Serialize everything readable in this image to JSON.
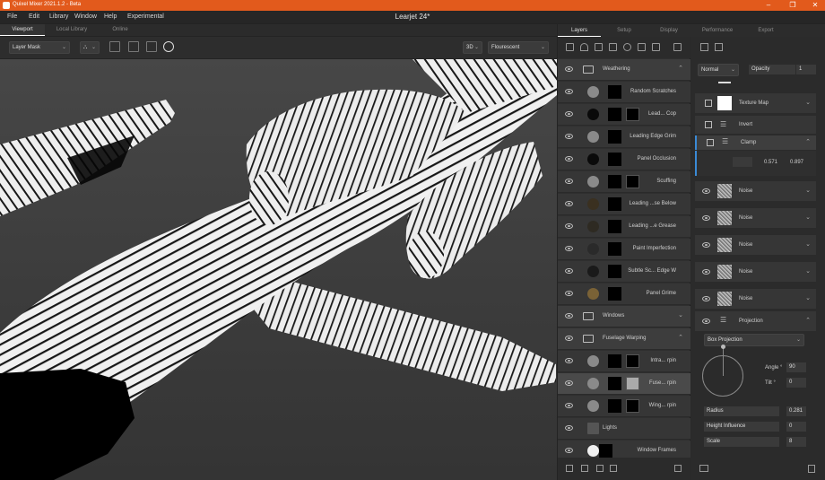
{
  "app": {
    "title": "Quixel Mixer 2021.1.2 - Beta",
    "document": "Learjet 24*"
  },
  "window_controls": {
    "minimize": "–",
    "maximize": "❐",
    "close": "✕"
  },
  "menu": [
    "File",
    "Edit",
    "Library",
    "Window",
    "Help",
    "Experimental"
  ],
  "left_tabs": [
    "Viewport",
    "Local Library",
    "Online"
  ],
  "viewport_toolbar": {
    "mask_dropdown": "Layer Mask",
    "view_mode": "3D",
    "lighting": "Flourescent"
  },
  "right_tabs": [
    "Layers",
    "Setup",
    "Display",
    "Performance",
    "Export"
  ],
  "layers": [
    {
      "type": "folder",
      "name": "Weathering",
      "expanded": true
    },
    {
      "type": "layer",
      "name": "Random Scratches",
      "color": "#8a8a8a"
    },
    {
      "type": "layer",
      "name": "Lead... Cop",
      "color": "#0a0a0a"
    },
    {
      "type": "layer",
      "name": "Leading Edge Grim",
      "color": "#8a8a8a"
    },
    {
      "type": "layer",
      "name": "Panel Occlusion",
      "color": "#0a0a0a"
    },
    {
      "type": "layer",
      "name": "Scuffing",
      "color": "#8a8a8a"
    },
    {
      "type": "layer",
      "name": "Leading ...se Below",
      "color": "#3a3020"
    },
    {
      "type": "layer",
      "name": "Leading ...e Grease",
      "color": "#2e2a22"
    },
    {
      "type": "layer",
      "name": "Paint Imperfection",
      "color": "#2a2a2a"
    },
    {
      "type": "layer",
      "name": "Subtle Sc... Edge W",
      "color": "#1a1a1a"
    },
    {
      "type": "layer",
      "name": "Panel Grime",
      "color": "#7a6236"
    },
    {
      "type": "folder",
      "name": "Windows",
      "expanded": false
    },
    {
      "type": "folder",
      "name": "Fuselage Warping",
      "expanded": true
    },
    {
      "type": "layer",
      "name": "Intra... rpin",
      "color": "#8a8a8a"
    },
    {
      "type": "layer",
      "name": "Fuse... rpin",
      "color": "#8a8a8a",
      "selected": true
    },
    {
      "type": "layer",
      "name": "Wing... rpin",
      "color": "#8a8a8a"
    },
    {
      "type": "layer",
      "name": "Lights",
      "color": "#555555"
    },
    {
      "type": "layer",
      "name": "Window Frames",
      "color": "#f0f0f0"
    }
  ],
  "props": {
    "blend_mode": "Normal",
    "opacity_label": "Opacity",
    "opacity_value": "1",
    "modifiers": [
      {
        "name": "Texture Map",
        "kind": "texture"
      },
      {
        "name": "Invert",
        "kind": "invert"
      },
      {
        "name": "Clamp",
        "kind": "clamp",
        "min": "0.571",
        "max": "0.897"
      },
      {
        "name": "Noise",
        "kind": "noise"
      },
      {
        "name": "Noise",
        "kind": "noise"
      },
      {
        "name": "Noise",
        "kind": "noise"
      },
      {
        "name": "Noise",
        "kind": "noise"
      },
      {
        "name": "Noise",
        "kind": "noise"
      }
    ],
    "projection": {
      "title": "Projection",
      "mode": "Box Projection",
      "angle_label": "Angle °",
      "angle": "90",
      "tilt_label": "Tilt °",
      "tilt": "0",
      "radius_label": "Radius",
      "radius": "0.281",
      "height_label": "Height Influence",
      "height": "0",
      "scale_label": "Scale",
      "scale": "8"
    }
  }
}
